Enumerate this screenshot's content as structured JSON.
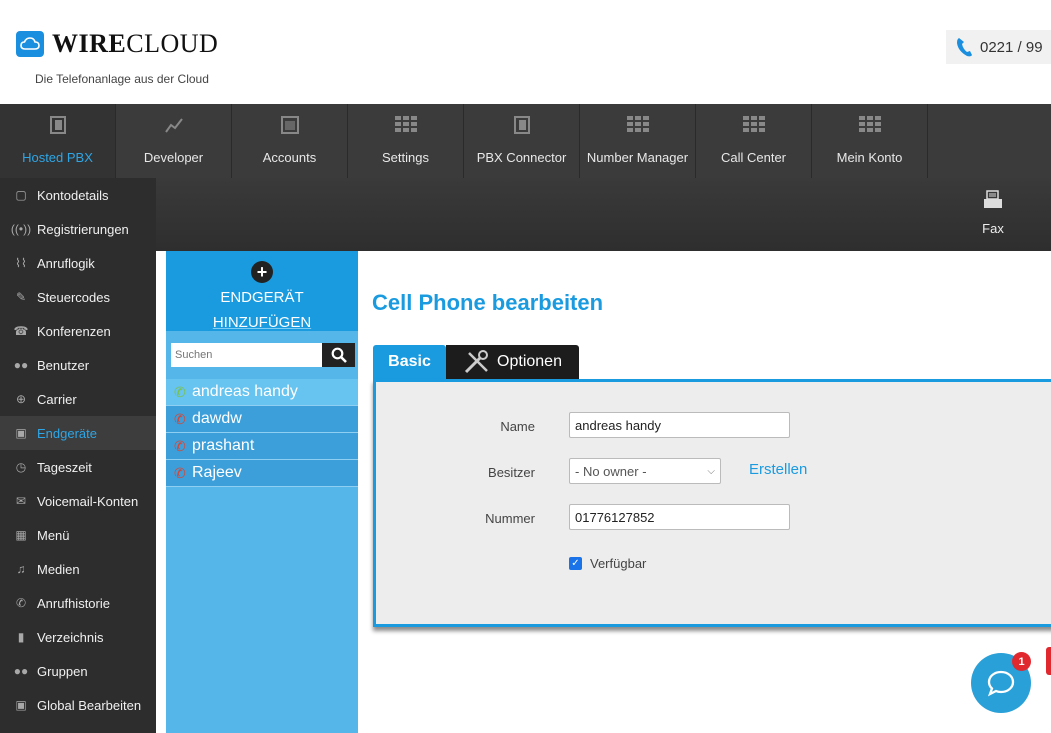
{
  "header": {
    "logo_bold": "WIRE",
    "logo_light": "CLOUD",
    "tagline": "Die Telefonanlage aus der Cloud",
    "phone": "0221 / 99"
  },
  "topnav": [
    {
      "label": "Hosted PBX",
      "icon": "device-icon",
      "active": true
    },
    {
      "label": "Developer",
      "icon": "chart-icon"
    },
    {
      "label": "Accounts",
      "icon": "window-icon"
    },
    {
      "label": "Settings",
      "icon": "grid-icon"
    },
    {
      "label": "PBX Connector",
      "icon": "device-icon"
    },
    {
      "label": "Number Manager",
      "icon": "grid-icon"
    },
    {
      "label": "Call Center",
      "icon": "grid-icon"
    },
    {
      "label": "Mein Konto",
      "icon": "grid-icon"
    }
  ],
  "subbar": {
    "fax_label": "Fax"
  },
  "sidebar": [
    {
      "label": "Kontodetails"
    },
    {
      "label": "Registrierungen"
    },
    {
      "label": "Anruflogik"
    },
    {
      "label": "Steuercodes"
    },
    {
      "label": "Konferenzen"
    },
    {
      "label": "Benutzer"
    },
    {
      "label": "Carrier"
    },
    {
      "label": "Endgeräte",
      "active": true
    },
    {
      "label": "Tageszeit"
    },
    {
      "label": "Voicemail-Konten"
    },
    {
      "label": "Menü"
    },
    {
      "label": "Medien"
    },
    {
      "label": "Anrufhistorie"
    },
    {
      "label": "Verzeichnis"
    },
    {
      "label": "Gruppen"
    },
    {
      "label": "Global Bearbeiten"
    }
  ],
  "devices": {
    "add_label_1": "ENDGERÄT",
    "add_label_2": "HINZUFÜGEN",
    "search_placeholder": "Suchen",
    "items": [
      {
        "name": "andreas handy",
        "status": "green",
        "selected": true
      },
      {
        "name": "dawdw",
        "status": "red"
      },
      {
        "name": "prashant",
        "status": "red"
      },
      {
        "name": "Rajeev",
        "status": "red"
      }
    ]
  },
  "main": {
    "title": "Cell Phone bearbeiten",
    "tab_basic": "Basic",
    "tab_options": "Optionen",
    "name_label": "Name",
    "name_value": "andreas handy",
    "owner_label": "Besitzer",
    "owner_value": "- No owner -",
    "create_link": "Erstellen",
    "number_label": "Nummer",
    "number_value": "01776127852",
    "available_label": "Verfügbar",
    "available_checked": true
  },
  "chat": {
    "badge": "1"
  },
  "colors": {
    "accent": "#1a9be0",
    "dark": "#2d2d2d",
    "list_bg": "#55b6ea",
    "green": "#7cc242",
    "red": "#e0412b"
  }
}
